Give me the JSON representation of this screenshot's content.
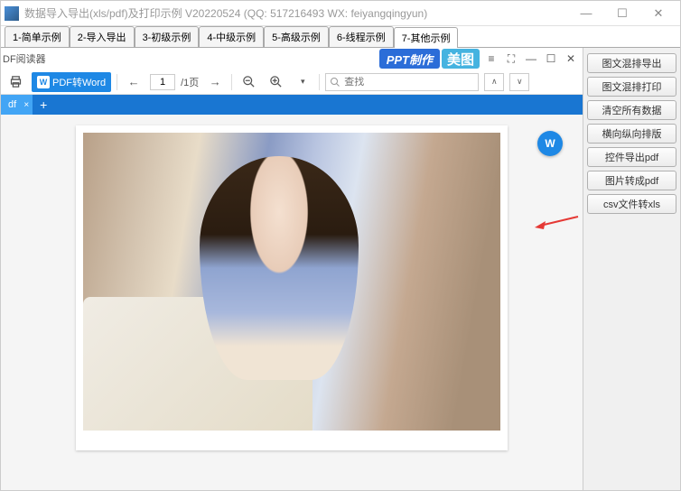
{
  "window": {
    "title": "数据导入导出(xls/pdf)及打印示例 V20220524 (QQ: 517216493 WX: feiyangqingyun)"
  },
  "tabs": [
    {
      "label": "1-简单示例"
    },
    {
      "label": "2-导入导出"
    },
    {
      "label": "3-初级示例"
    },
    {
      "label": "4-中级示例"
    },
    {
      "label": "5-高级示例"
    },
    {
      "label": "6-线程示例"
    },
    {
      "label": "7-其他示例"
    }
  ],
  "active_tab": 6,
  "reader": {
    "title": "DF阅读器",
    "badge_ppt": "PPT制作",
    "badge_meitu": "美图"
  },
  "toolbar": {
    "pdf2word": "PDF转Word",
    "page_current": "1",
    "page_total": "/1页",
    "search_placeholder": "查找"
  },
  "doctab": {
    "name": "df"
  },
  "sidebar": [
    {
      "label": "图文混排导出"
    },
    {
      "label": "图文混排打印"
    },
    {
      "label": "清空所有数据"
    },
    {
      "label": "横向纵向排版"
    },
    {
      "label": "控件导出pdf"
    },
    {
      "label": "图片转成pdf"
    },
    {
      "label": "csv文件转xls"
    }
  ],
  "arrow_target_index": 5
}
